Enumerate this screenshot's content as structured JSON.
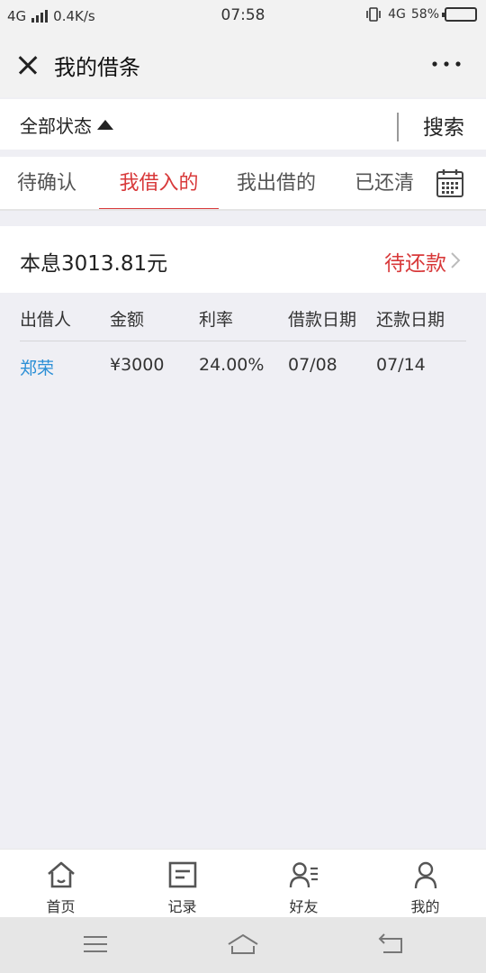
{
  "status_bar": {
    "network": "4G",
    "speed": "0.4K/s",
    "time": "07:58",
    "network_right": "4G",
    "battery": "58%",
    "battery_level": 0.58
  },
  "header": {
    "title": "我的借条"
  },
  "filter": {
    "status_label": "全部状态",
    "search_label": "搜索"
  },
  "tabs": [
    {
      "label": "待确认"
    },
    {
      "label": "我借入的"
    },
    {
      "label": "我出借的"
    },
    {
      "label": "已还清"
    }
  ],
  "summary": {
    "principal": "本息3013.81元",
    "status": "待还款"
  },
  "table": {
    "columns": [
      "出借人",
      "金额",
      "利率",
      "借款日期",
      "还款日期"
    ],
    "rows": [
      [
        "郑荣",
        "¥3000",
        "24.00%",
        "07/08",
        "07/14"
      ]
    ]
  },
  "bottom_nav": [
    {
      "label": "首页",
      "icon": "home-icon"
    },
    {
      "label": "记录",
      "icon": "record-icon"
    },
    {
      "label": "好友",
      "icon": "friends-icon"
    },
    {
      "label": "我的",
      "icon": "profile-icon"
    }
  ],
  "colors": {
    "accent": "#d8393a",
    "link": "#2b8fd6",
    "background": "#efeff4"
  }
}
